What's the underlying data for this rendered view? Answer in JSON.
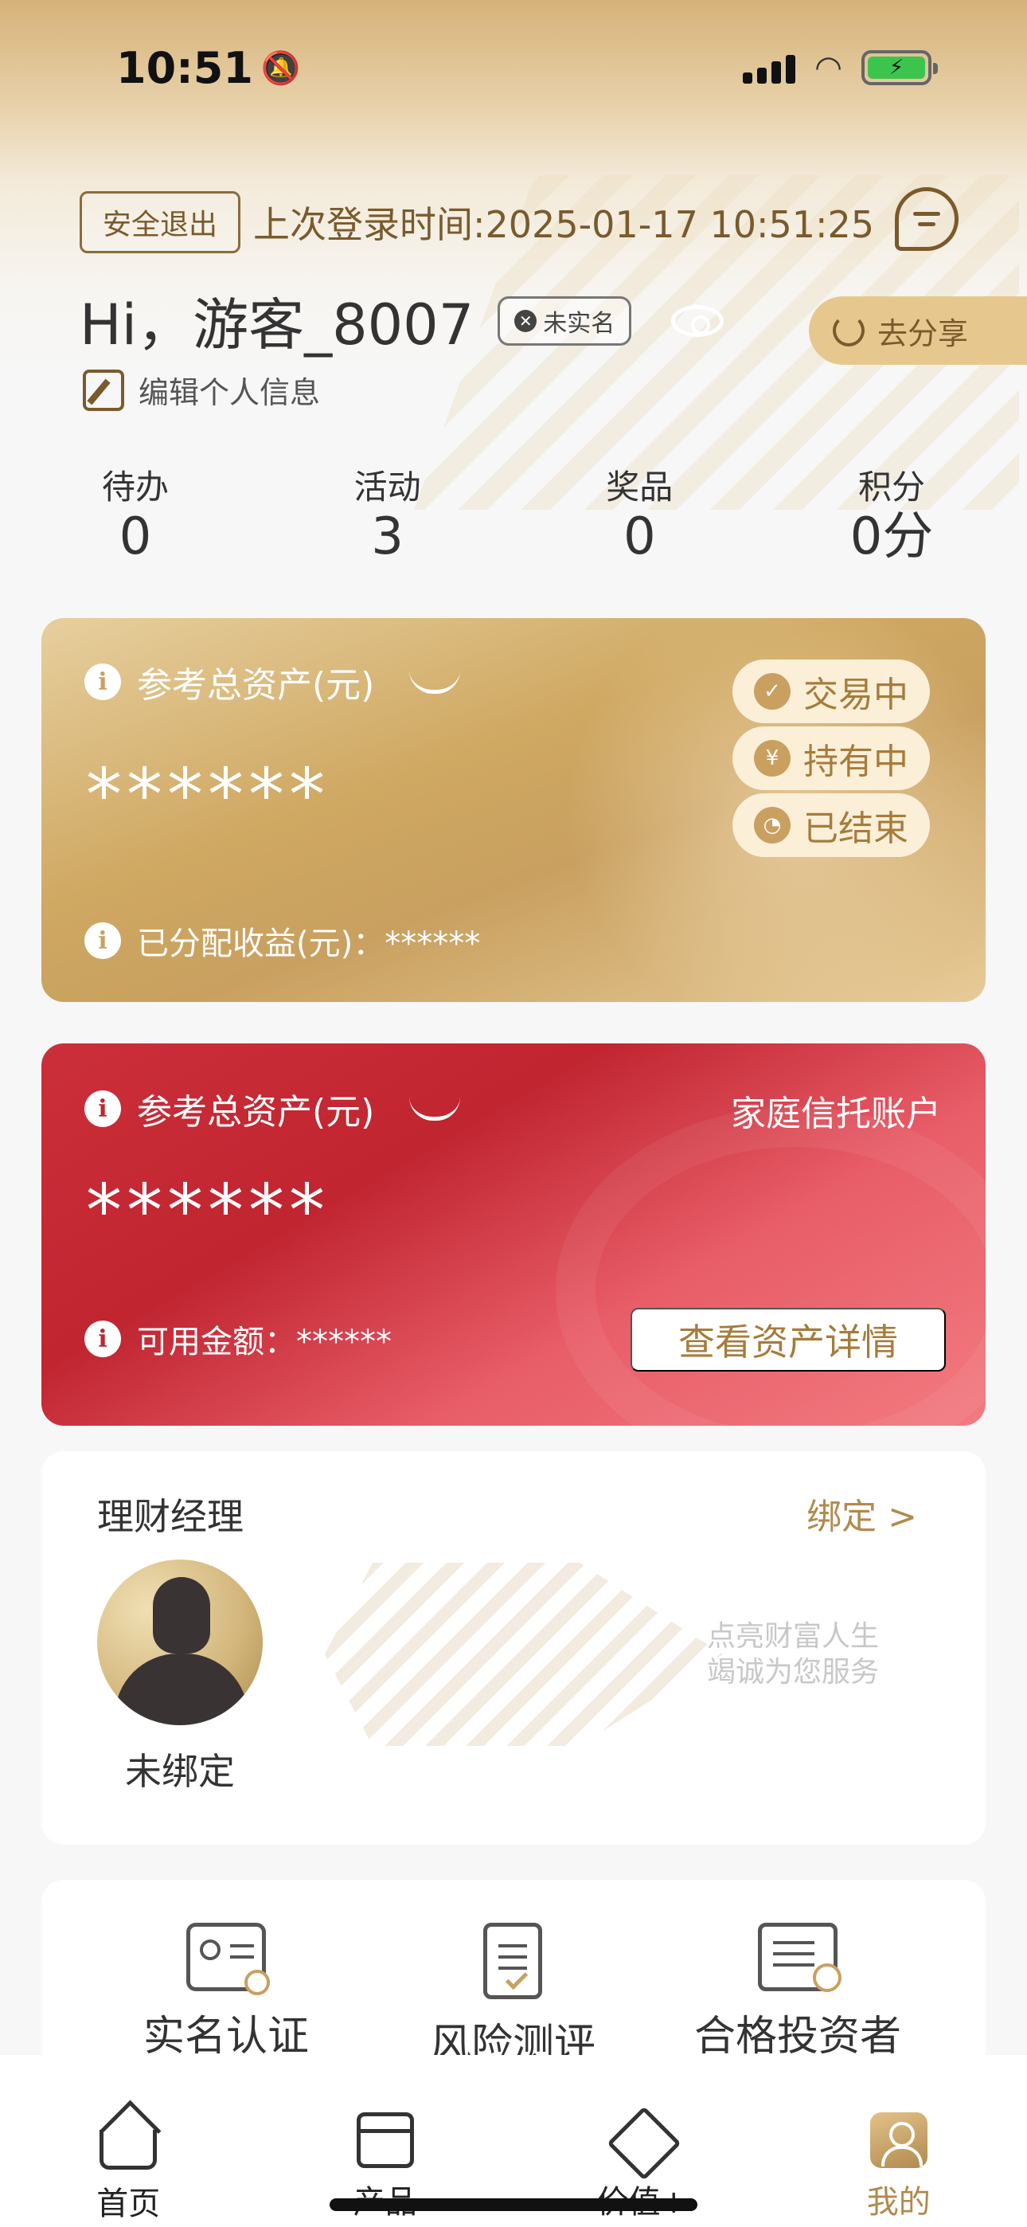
{
  "status_bar": {
    "time": "10:51"
  },
  "header": {
    "logout_label": "安全退出",
    "last_login": "上次登录时间:2025-01-17 10:51:25",
    "greeting": "Hi，游客_8007",
    "badge_unverified": "未实名",
    "share_label": "去分享",
    "edit_profile_label": "编辑个人信息"
  },
  "stats": [
    {
      "label": "待办",
      "value": "0"
    },
    {
      "label": "活动",
      "value": "3"
    },
    {
      "label": "奖品",
      "value": "0"
    },
    {
      "label": "积分",
      "value": "0分"
    }
  ],
  "asset_card": {
    "title": "参考总资产(元)",
    "amount": "******",
    "earnings": "已分配收益(元)：******",
    "pills": [
      "交易中",
      "持有中",
      "已结束"
    ]
  },
  "family_card": {
    "title": "参考总资产(元)",
    "account_label": "家庭信托账户",
    "amount": "******",
    "available": "可用金额：******",
    "detail_button": "查看资产详情"
  },
  "advisor": {
    "title": "理财经理",
    "bind_label": "绑定 >",
    "status": "未绑定",
    "slogan_line1": "点亮财富人生",
    "slogan_line2": "竭诚为您服务"
  },
  "services": [
    {
      "label": "实名认证",
      "icon": "id-card-icon"
    },
    {
      "label": "风险测评",
      "icon": "clipboard-check-icon"
    },
    {
      "label": "合格投资者",
      "icon": "certificate-icon"
    }
  ],
  "tabbar": [
    {
      "label": "首页",
      "icon": "home-icon"
    },
    {
      "label": "产品",
      "icon": "box-icon"
    },
    {
      "label": "价值+",
      "icon": "diamond-icon"
    },
    {
      "label": "我的",
      "icon": "profile-icon",
      "active": true
    }
  ],
  "colors": {
    "gold": "#c9a060",
    "red": "#c02530",
    "accent_text": "#b08a4e"
  }
}
